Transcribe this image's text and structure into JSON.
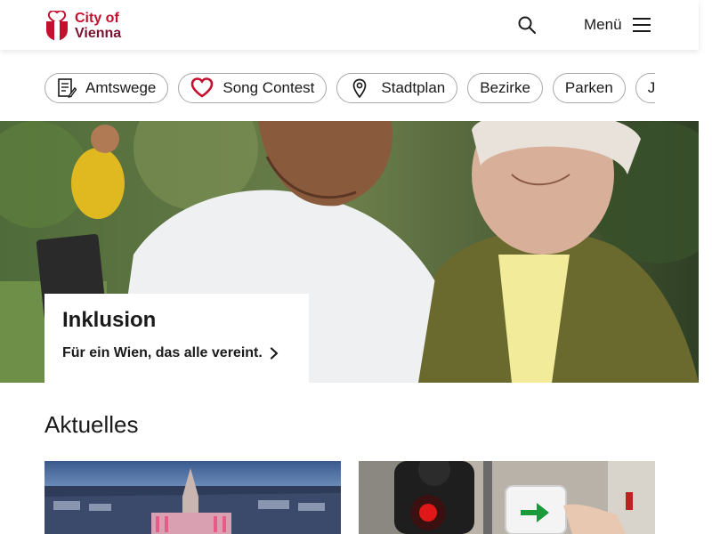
{
  "header": {
    "logo_line1": "City of",
    "logo_line2": "Vienna",
    "menu_label": "Menü"
  },
  "quick_links": [
    {
      "label": "Amtswege",
      "icon": "document-edit-icon"
    },
    {
      "label": "Song Contest",
      "icon": "heart-icon"
    },
    {
      "label": "Stadtplan",
      "icon": "map-pin-icon"
    },
    {
      "label": "Bezirke"
    },
    {
      "label": "Parken"
    },
    {
      "label": "Jo"
    }
  ],
  "hero": {
    "title": "Inklusion",
    "link_text": "Für ein Wien, das alle vereint."
  },
  "news": {
    "heading": "Aktuelles"
  },
  "colors": {
    "brand_red": "#c4102e",
    "brand_dark_red": "#7a1230",
    "chip_border": "#a8a8a8"
  }
}
